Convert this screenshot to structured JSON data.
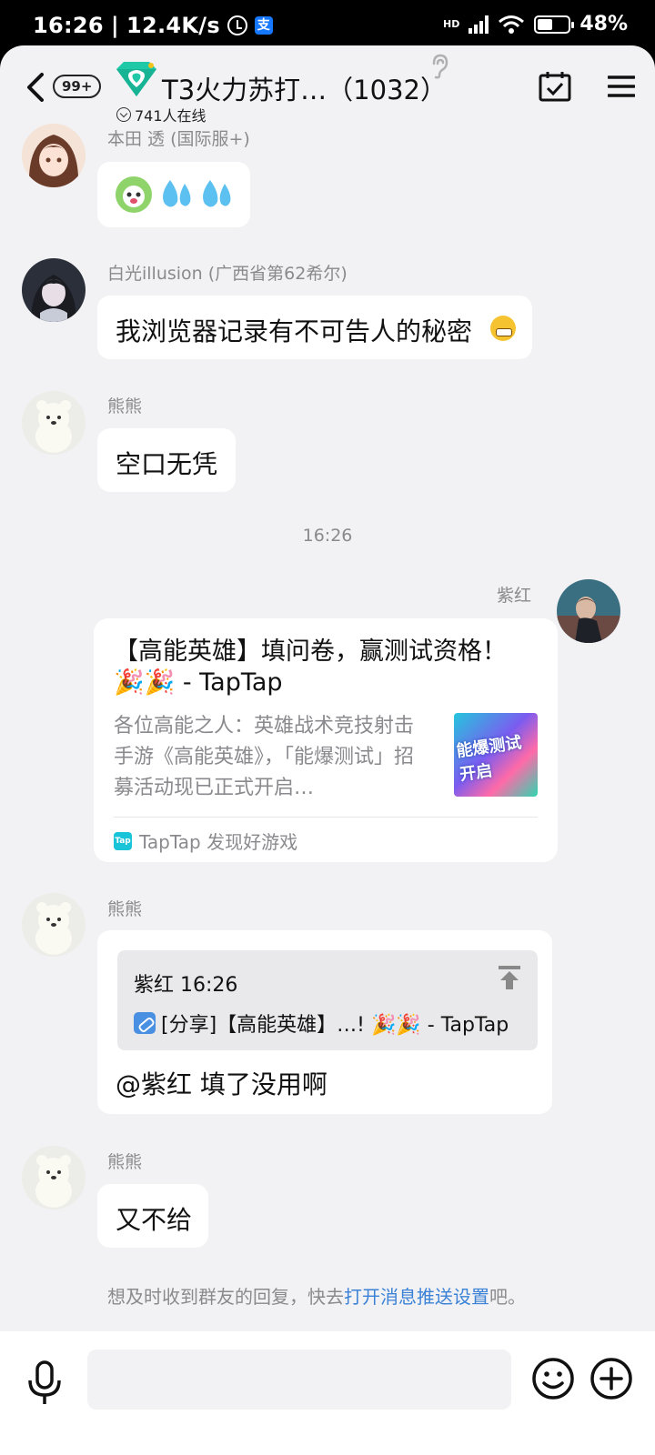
{
  "status_bar": {
    "time": "16:26",
    "speed": "12.4K/s",
    "network": "HD",
    "battery": "48%"
  },
  "header": {
    "back_badge": "99+",
    "group_name": "T3火力苏打…（1032）",
    "online_count": "741人在线"
  },
  "messages": [
    {
      "sender": "本田 透 (国际服+)",
      "text": ""
    },
    {
      "sender": "白光illusion (广西省第62希尔)",
      "text": "我浏览器记录有不可告人的秘密"
    },
    {
      "sender": "熊熊",
      "text": "空口无凭"
    },
    {
      "timestamp": "16:26"
    },
    {
      "sender": "紫红",
      "card": {
        "title": "【高能英雄】填问卷，赢测试资格！🎉🎉 - TapTap",
        "description": "各位高能之人：英雄战术竞技射击手游《高能英雄》，「能爆测试」招募活动现已正式开启…",
        "thumb_text": "能爆测试开启",
        "source_icon": "Tap",
        "source": "TapTap 发现好游戏"
      }
    },
    {
      "sender": "熊熊",
      "quote_head": "紫红 16:26",
      "quote_body": "[分享]【高能英雄】…! 🎉🎉 - TapTap",
      "text": "@紫红 填了没用啊"
    },
    {
      "sender": "熊熊",
      "text": "又不给"
    }
  ],
  "notice": {
    "prefix": "想及时收到群友的回复，快去",
    "link": "打开消息推送设置",
    "suffix": "吧。"
  },
  "colors": {
    "background": "#f2f2f4",
    "bubble": "#ffffff",
    "link": "#3b82d6",
    "muted_text": "#8a8a8e"
  }
}
